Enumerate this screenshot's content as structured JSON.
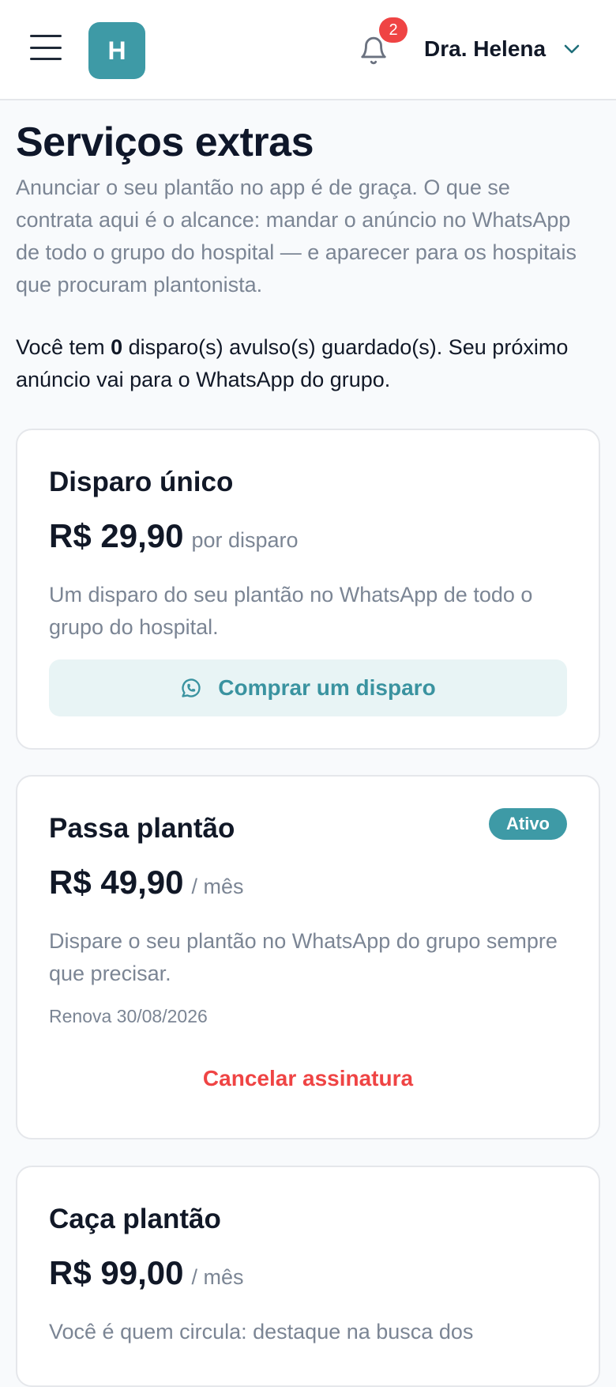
{
  "header": {
    "logo_letter": "H",
    "notification_count": "2",
    "user_name": "Dra. Helena",
    "icons": {
      "menu": "hamburger-menu-icon",
      "notifications": "bell-icon",
      "user_menu": "chevron-down-icon"
    }
  },
  "page": {
    "title": "Serviços extras",
    "intro": "Anunciar o seu plantão no app é de graça. O que se contrata aqui é o alcance: mandar o anúncio no WhatsApp de todo o grupo do hospital — e aparecer para os hospitais que procuram plantonista.",
    "balance": {
      "prefix": "Você tem ",
      "count": "0",
      "suffix": " disparo(s) avulso(s) guardado(s). Seu próximo anúncio vai para o WhatsApp do grupo."
    }
  },
  "plans": [
    {
      "title": "Disparo único",
      "price": "R$ 29,90",
      "per": "por disparo",
      "description": "Um disparo do seu plantão no WhatsApp de todo o grupo do hospital.",
      "button_label": "Comprar um disparo",
      "button_icon": "whatsapp-icon"
    },
    {
      "title": "Passa plantão",
      "status": "Ativo",
      "price": "R$ 49,90",
      "per": "/ mês",
      "description": "Dispare o seu plantão no WhatsApp do grupo sempre que precisar.",
      "renewal": "Renova 30/08/2026",
      "cancel_label": "Cancelar assinatura"
    },
    {
      "title": "Caça plantão",
      "price": "R$ 99,00",
      "per": "/ mês",
      "description": "Você é quem circula: destaque na busca dos"
    }
  ],
  "colors": {
    "accent": "#3e9aa6",
    "accent_soft": "#e8f4f5",
    "danger": "#ef4444",
    "text": "#111827",
    "muted": "#7b8594",
    "background": "#f8fafc"
  }
}
